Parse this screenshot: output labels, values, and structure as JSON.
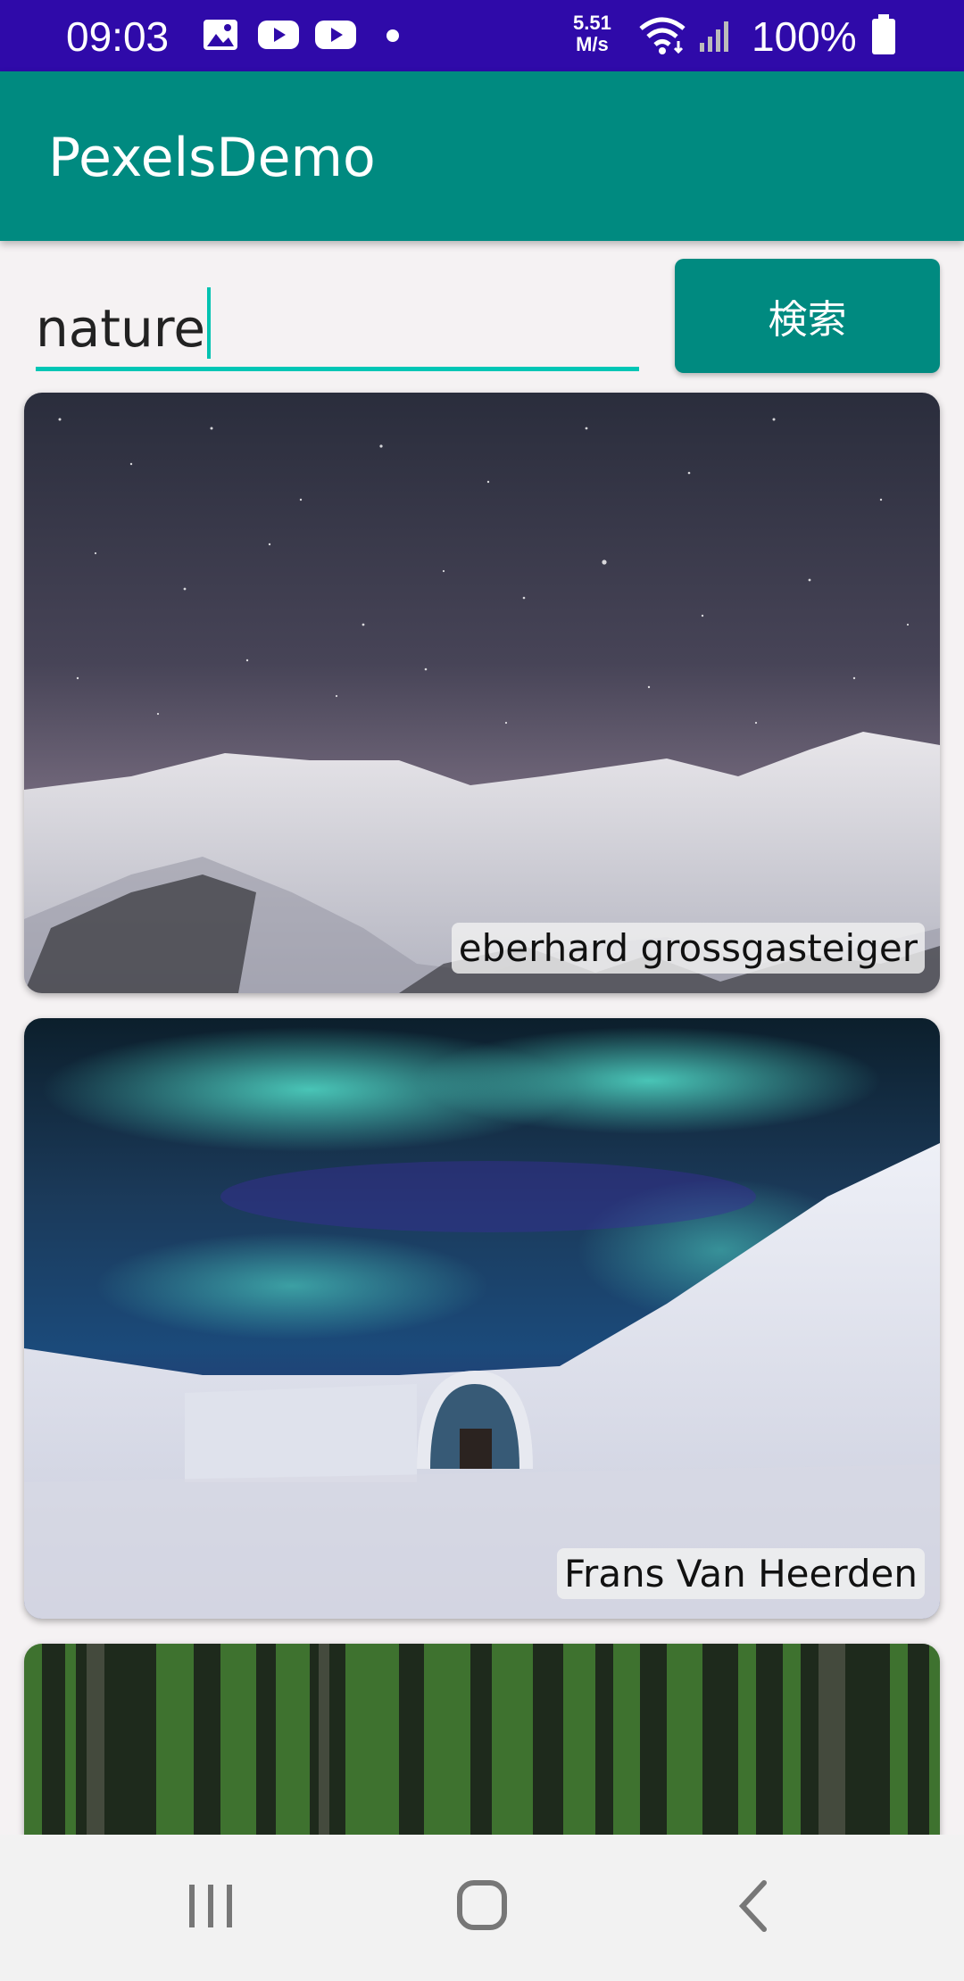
{
  "status_bar": {
    "time": "09:03",
    "net_speed_value": "5.51",
    "net_speed_unit": "M/s",
    "battery": "100%",
    "icons": [
      "gallery-icon",
      "youtube-icon",
      "youtube-icon",
      "dot-icon",
      "wifi-icon",
      "signal-icon",
      "battery-icon"
    ]
  },
  "app_bar": {
    "title": "PexelsDemo",
    "color": "#008a80"
  },
  "search": {
    "value": "nature",
    "button_label": "検索",
    "accent": "#00c6b5"
  },
  "photos": [
    {
      "photographer": "eberhard grossgasteiger",
      "subject": "snowy-mountains-night-sky"
    },
    {
      "photographer": "Frans Van Heerden",
      "subject": "aurora-igloo"
    },
    {
      "photographer": "",
      "subject": "forest"
    }
  ],
  "nav_bar": {
    "buttons": [
      "recents-icon",
      "home-icon",
      "back-icon"
    ]
  }
}
